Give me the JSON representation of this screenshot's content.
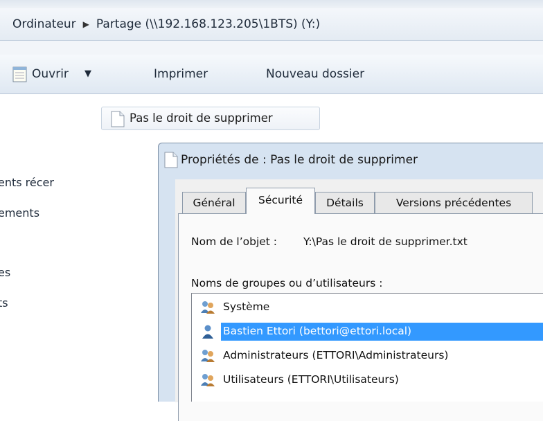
{
  "breadcrumb": {
    "computer": "Ordinateur",
    "separator": "▶",
    "share": "Partage (\\\\192.168.123.205\\1BTS) (Y:)"
  },
  "toolbar": {
    "open_label": "Ouvrir",
    "open_arrow": "▼",
    "print_label": "Imprimer",
    "new_folder_label": "Nouveau dossier"
  },
  "nav": {
    "items": [
      "ents récer",
      "ements",
      "es",
      "ts"
    ]
  },
  "file": {
    "name": "Pas le droit de supprimer"
  },
  "dialog": {
    "title": "Propriétés de : Pas le droit de supprimer",
    "tabs": [
      "Général",
      "Sécurité",
      "Détails",
      "Versions précédentes"
    ],
    "active_tab": "Sécurité",
    "object_name_label": "Nom de l’objet :",
    "object_name_value": "Y:\\Pas le droit de supprimer.txt",
    "groups_label": "Noms de groupes ou d’utilisateurs :",
    "principals": [
      {
        "name": "Système",
        "icon": "group-icon",
        "selected": false
      },
      {
        "name": "Bastien Ettori (bettori@ettori.local)",
        "icon": "user-icon",
        "selected": true
      },
      {
        "name": "Administrateurs (ETTORI\\Administrateurs)",
        "icon": "group-icon",
        "selected": false
      },
      {
        "name": "Utilisateurs (ETTORI\\Utilisateurs)",
        "icon": "group-icon",
        "selected": false
      }
    ]
  },
  "colors": {
    "selection": "#3399ff",
    "dialog_frame": "#d6e3f1",
    "toolbar": "#dfe8f2"
  }
}
